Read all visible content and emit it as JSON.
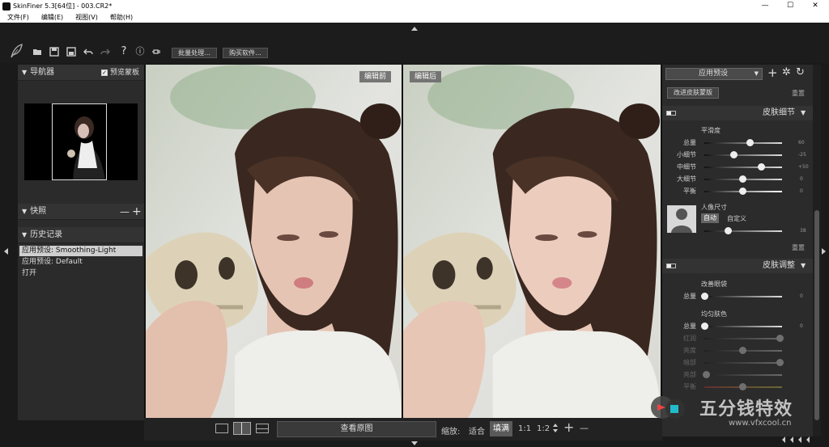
{
  "window": {
    "title": "SkinFiner 5.3[64位] - 003.CR2*",
    "min_glyph": "—",
    "max_glyph": "☐",
    "close_glyph": "✕"
  },
  "menu": [
    "文件(F)",
    "编辑(E)",
    "视图(V)",
    "帮助(H)"
  ],
  "toolbar": {
    "batch_label": "批量处理...",
    "buy_label": "购买软件...",
    "help_glyph": "?",
    "info_glyph": "ⓘ"
  },
  "navigator": {
    "title": "导航器",
    "preview_mask_label": "预览蒙板",
    "preview_mask_checked": true
  },
  "snapshots": {
    "title": "快照",
    "minus": "—",
    "plus": "+"
  },
  "history": {
    "title": "历史记录",
    "items": [
      "应用预设: Smoothing-Light",
      "应用预设: Default",
      "打开"
    ],
    "selected_index": 0
  },
  "photo": {
    "before_label": "编辑前",
    "after_label": "编辑后"
  },
  "bottom": {
    "view_original": "查看原图",
    "zoom_label": "缩放:",
    "fit": "适合",
    "fill": "填满",
    "z11": "1:1",
    "z12": "1:2",
    "plus": "+",
    "minus": "—"
  },
  "right": {
    "preset_label": "应用预设",
    "improve_button": "改进皮肤蒙版",
    "reset": "重置",
    "skin_detail": {
      "title": "皮肤细节",
      "subtitle": "平滑度",
      "sliders": [
        {
          "label": "总量",
          "value": "60",
          "pos": 0.57
        },
        {
          "label": "小细节",
          "value": "-25",
          "pos": 0.37
        },
        {
          "label": "中细节",
          "value": "+50",
          "pos": 0.73
        },
        {
          "label": "大细节",
          "value": "0",
          "pos": 0.5
        },
        {
          "label": "平衡",
          "value": "0",
          "pos": 0.5
        }
      ],
      "portrait_size_label": "人像尺寸",
      "auto_label": "自动",
      "custom_label": "自定义",
      "portrait_value": "38",
      "portrait_pos": 0.3,
      "reset": "重置"
    },
    "skin_tone": {
      "title": "皮肤调整",
      "eyebag_title": "改善眼袋",
      "eyebag_label": "总量",
      "eyebag_value": "0",
      "uniform_title": "均匀肤色",
      "uniform_label": "总量",
      "uniform_value": "0",
      "faded": [
        {
          "label": "红润",
          "pos": 0.97
        },
        {
          "label": "亮度",
          "pos": 0.5
        },
        {
          "label": "暗部",
          "pos": 0.97
        },
        {
          "label": "亮部",
          "pos": 0.02
        },
        {
          "label": "平衡",
          "pos": 0.5
        }
      ]
    }
  },
  "watermark": {
    "cn": "五分钱特效",
    "url": "www.vfxcool.cn"
  }
}
